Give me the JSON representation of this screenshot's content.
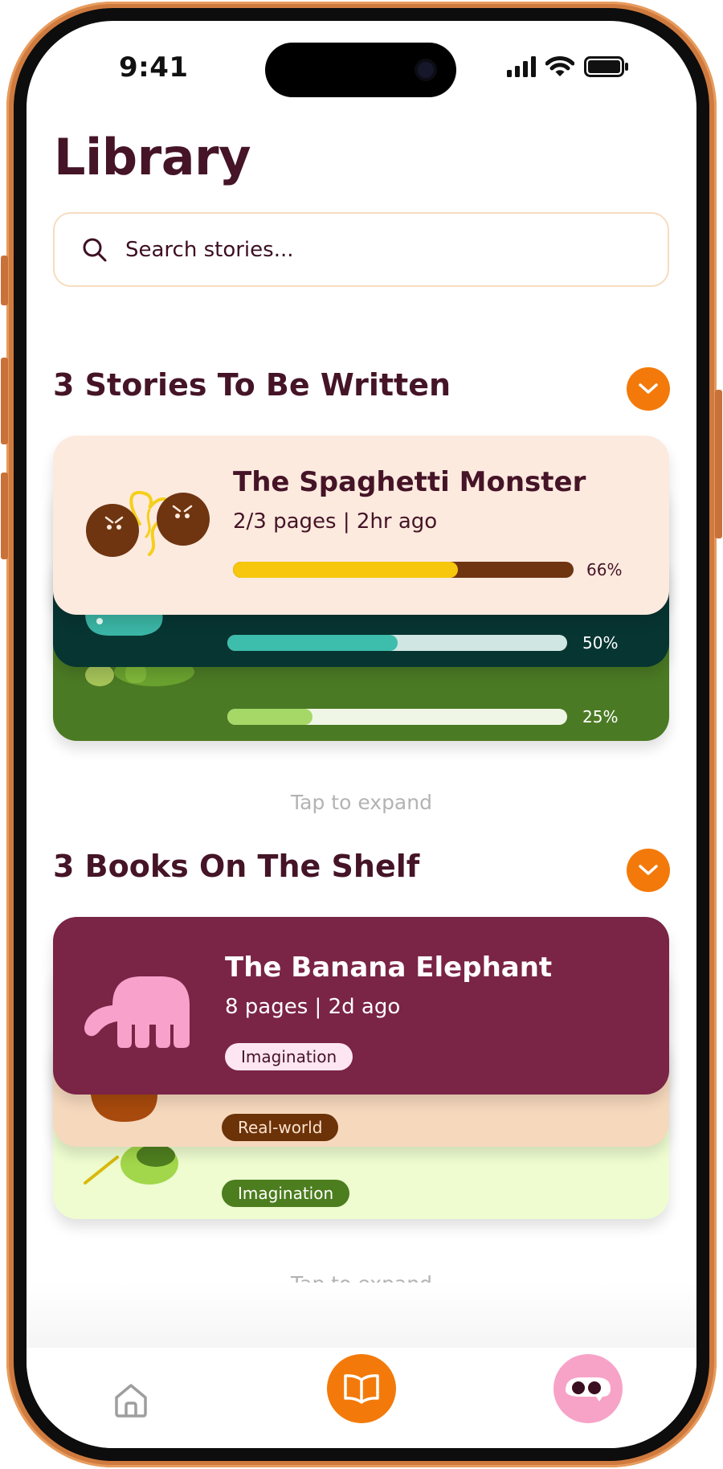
{
  "status_bar": {
    "time": "9:41"
  },
  "header": {
    "title": "Library"
  },
  "search": {
    "placeholder": "Search stories..."
  },
  "colors": {
    "accent": "#f37a0a",
    "title_text": "#451427",
    "card_spaghetti_bg": "#fdeadf",
    "card_teal_bg": "#073532",
    "card_green_bg": "#4b7a24",
    "card_banana_bg": "#7a2446",
    "card_peach_bg": "#f6d8bd",
    "card_lime_bg": "#eefcd0"
  },
  "stories_section": {
    "title": "3 Stories To Be Written",
    "icon": "chevron-down-icon",
    "tap_hint": "Tap to expand",
    "cards": [
      {
        "title": "The Spaghetti Monster",
        "meta": "2/3 pages | 2hr ago",
        "progress": 0.66,
        "progress_label": "66%"
      },
      {
        "progress": 0.5,
        "progress_label": "50%"
      },
      {
        "progress": 0.25,
        "progress_label": "25%"
      }
    ]
  },
  "books_section": {
    "title": "3 Books On The Shelf",
    "icon": "chevron-down-icon",
    "tap_hint": "Tap to expand",
    "cards": [
      {
        "title": "The Banana Elephant",
        "meta": "8 pages | 2d ago",
        "tag": "Imagination"
      },
      {
        "tag": "Real-world"
      },
      {
        "tag": "Imagination"
      }
    ]
  },
  "bottom_nav": {
    "items": [
      {
        "icon": "home-icon",
        "active": false
      },
      {
        "icon": "open-book-icon",
        "active": true
      },
      {
        "icon": "avatar-icon",
        "active": false
      }
    ]
  }
}
